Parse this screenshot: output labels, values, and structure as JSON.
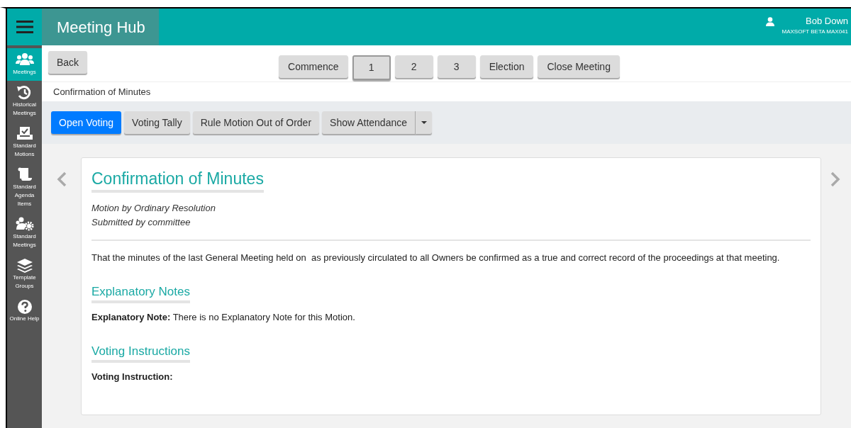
{
  "header": {
    "app_title": "Meeting Hub",
    "user_name": "Bob Down",
    "user_org": "MAXSOFT BETA MAX041"
  },
  "sidebar": {
    "items": [
      {
        "kind": "users",
        "label": "Meetings",
        "selected": true
      },
      {
        "kind": "history",
        "label": "Historical Meetings",
        "selected": false
      },
      {
        "kind": "ballot",
        "label": "Standard Motions",
        "selected": false
      },
      {
        "kind": "scroll",
        "label": "Standard Agenda Items",
        "selected": false
      },
      {
        "kind": "usersgear",
        "label": "Standard Meetings",
        "selected": false
      },
      {
        "kind": "layers",
        "label": "Template Groups",
        "selected": false
      },
      {
        "kind": "help",
        "label": "Online Help",
        "selected": false
      }
    ]
  },
  "nav": {
    "back": "Back",
    "stages": [
      {
        "label": "Commence",
        "selected": false
      },
      {
        "label": "1",
        "selected": true
      },
      {
        "label": "2",
        "selected": false
      },
      {
        "label": "3",
        "selected": false
      },
      {
        "label": "Election",
        "selected": false
      },
      {
        "label": "Close Meeting",
        "selected": false
      }
    ]
  },
  "breadcrumb": "Confirmation of Minutes",
  "actions": [
    {
      "label": "Open Voting",
      "kind": "primary"
    },
    {
      "label": "Voting Tally",
      "kind": "default"
    },
    {
      "label": "Rule Motion Out of Order",
      "kind": "default"
    },
    {
      "label": "Show Attendance",
      "kind": "split"
    }
  ],
  "motion": {
    "title": "Confirmation of Minutes",
    "type": "Motion by Ordinary Resolution",
    "submitted": "Submitted by committee",
    "body": "That the minutes of the last General Meeting held on  as previously circulated to all Owners be confirmed as a true and correct record of the proceedings at that meeting.",
    "sections": [
      {
        "heading": "Explanatory Notes",
        "label": "Explanatory Note:",
        "text": "There is no Explanatory Note for this Motion."
      },
      {
        "heading": "Voting Instructions",
        "label": "Voting Instruction:"
      }
    ]
  }
}
